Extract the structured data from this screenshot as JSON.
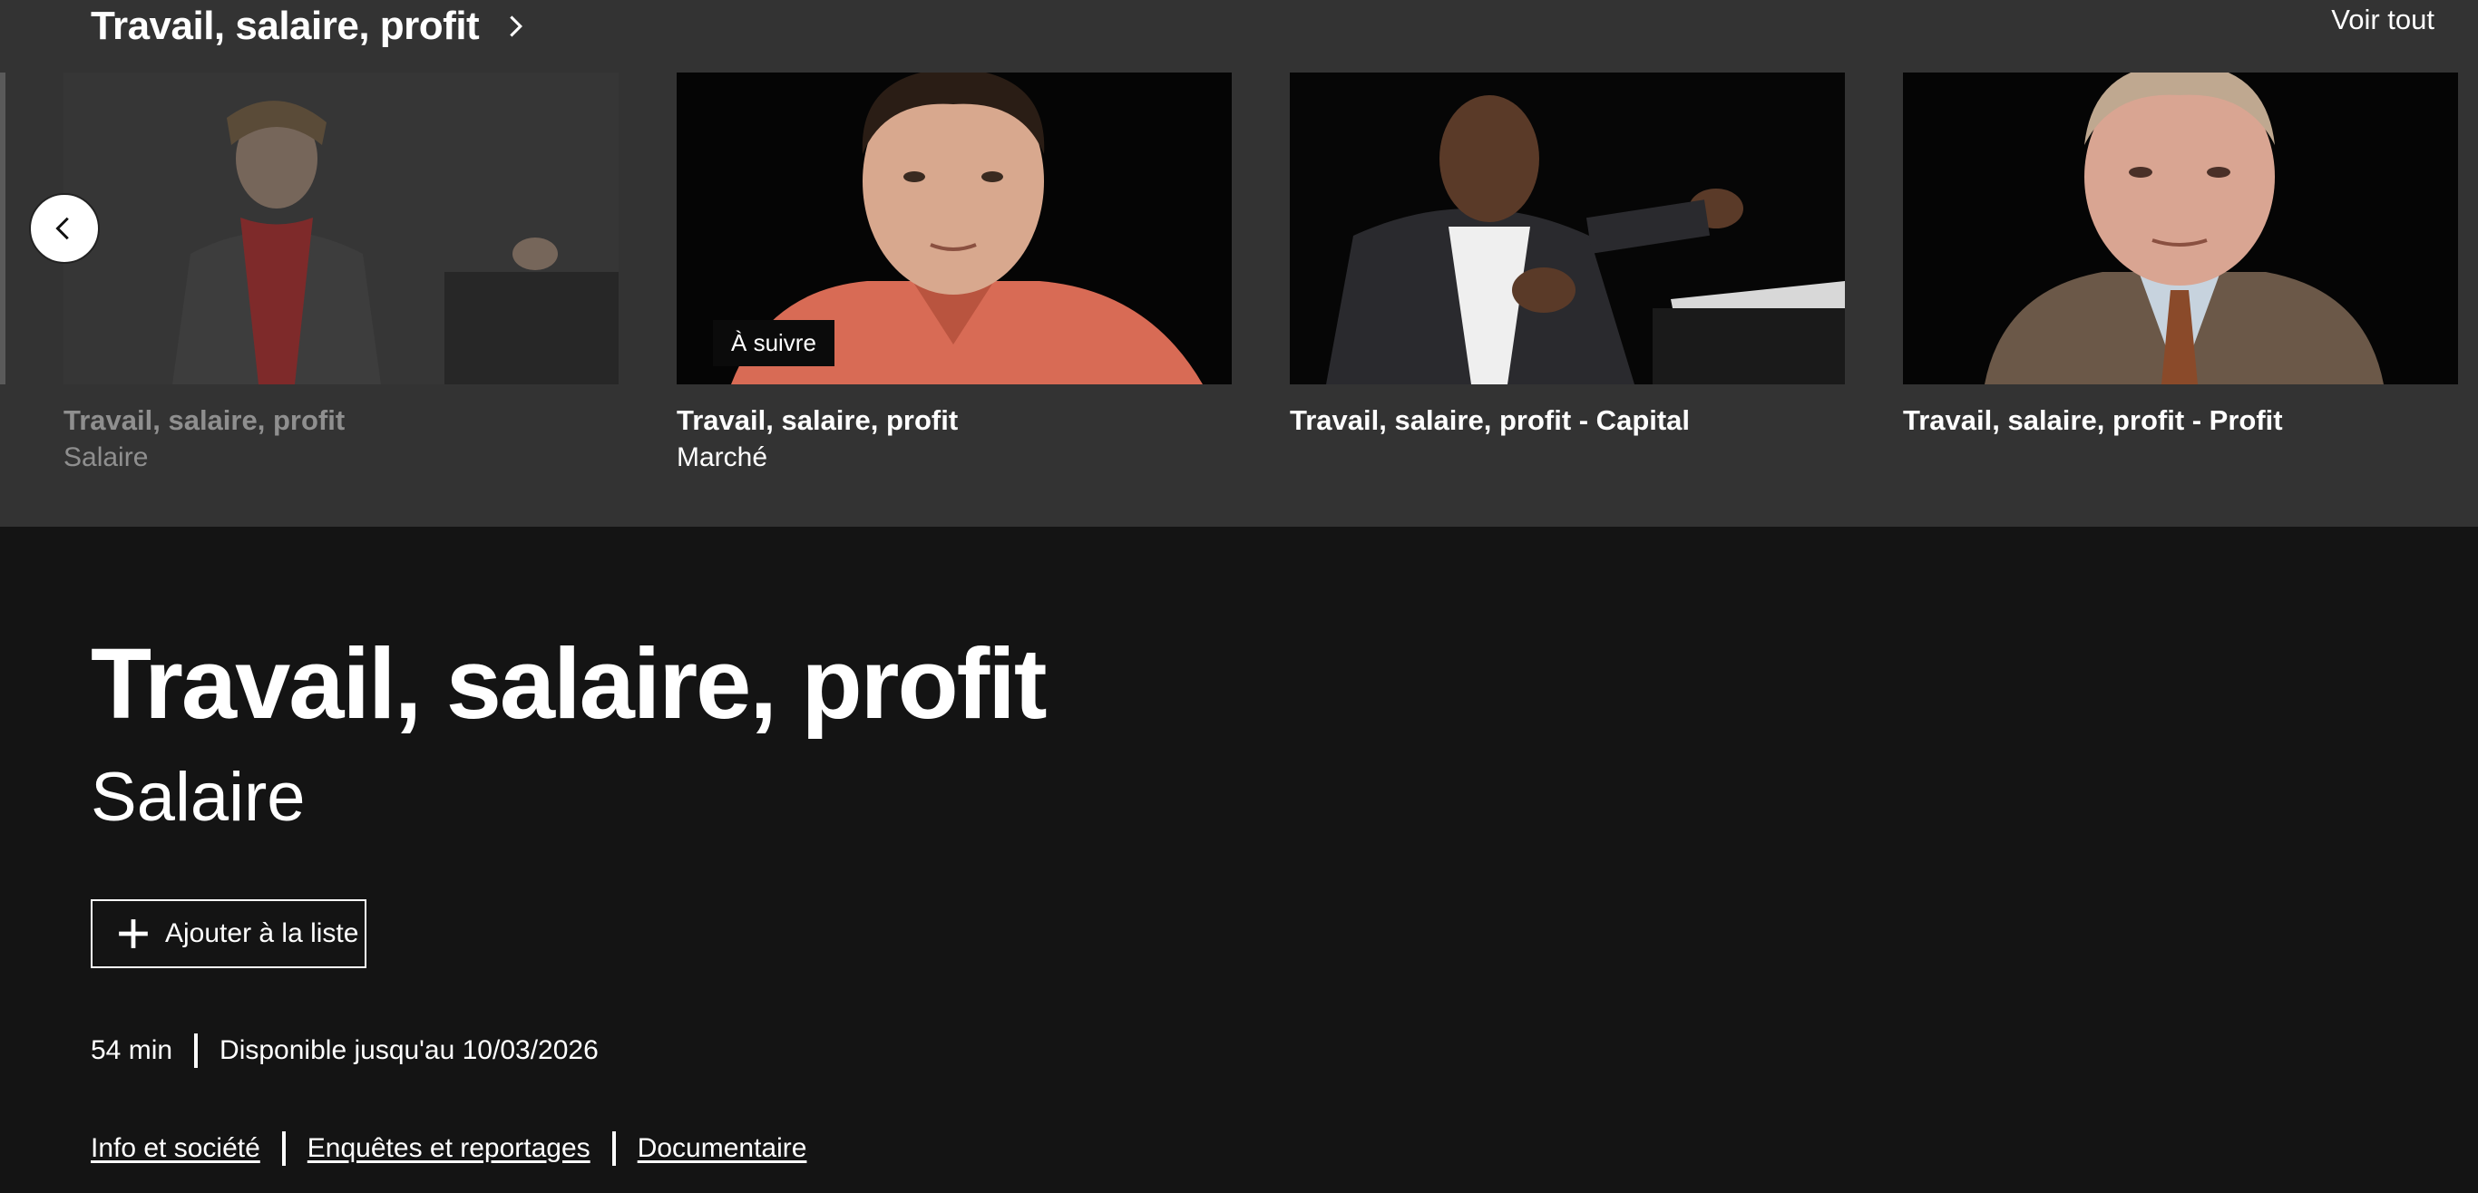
{
  "row": {
    "title": "Travail, salaire, profit",
    "see_all": "Voir tout"
  },
  "cards": [
    {
      "title": "Travail, salaire, profit",
      "subtitle": "Salaire",
      "badge": ""
    },
    {
      "title": "Travail, salaire, profit",
      "subtitle": "Marché",
      "badge": "À suivre"
    },
    {
      "title": "Travail, salaire, profit - Capital",
      "subtitle": "",
      "badge": ""
    },
    {
      "title": "Travail, salaire, profit - Profit",
      "subtitle": "",
      "badge": ""
    }
  ],
  "detail": {
    "title": "Travail, salaire, profit",
    "subtitle": "Salaire",
    "add_label": "Ajouter à la liste",
    "duration": "54 min",
    "availability": "Disponible jusqu'au 10/03/2026",
    "tags": [
      "Info et société",
      "Enquêtes et reportages",
      "Documentaire"
    ]
  },
  "icons": {
    "row_arrow": "chevron-right-icon",
    "prev": "chevron-left-icon",
    "add": "plus-icon"
  }
}
